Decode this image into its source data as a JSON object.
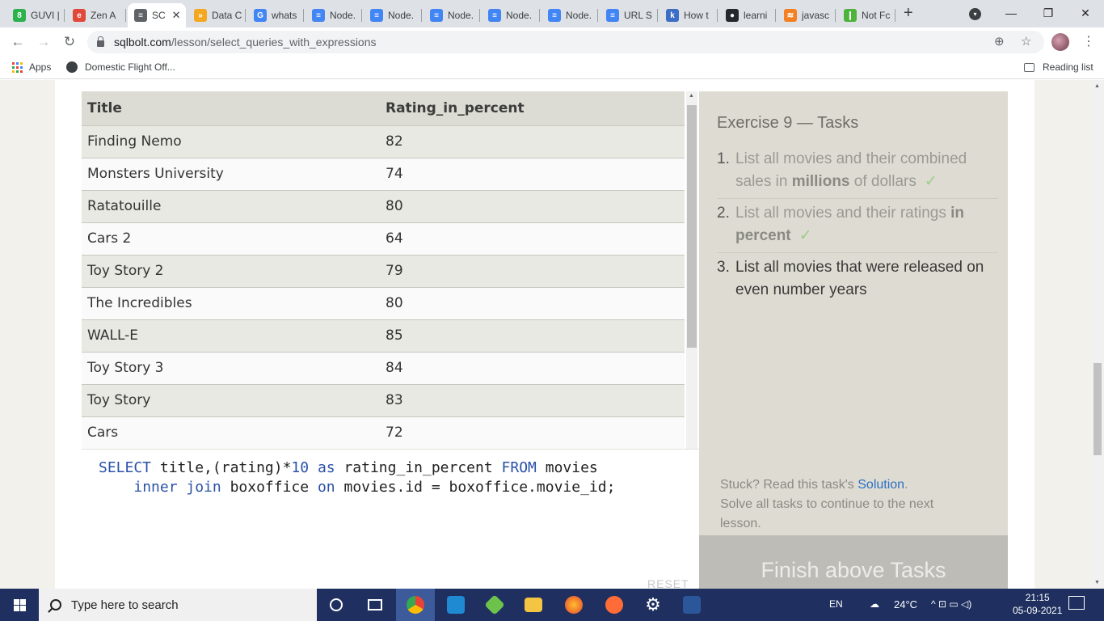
{
  "browser": {
    "tabs": [
      {
        "label": "GUVI |",
        "favicon_color": "#2bb24c",
        "favicon_glyph": "8"
      },
      {
        "label": "Zen A",
        "favicon_color": "#e0483a",
        "favicon_glyph": "e"
      },
      {
        "label": "SC",
        "favicon_color": "#5f6368",
        "favicon_glyph": "≡",
        "active": true,
        "close": "✕"
      },
      {
        "label": "Data C",
        "favicon_color": "#f4a821",
        "favicon_glyph": "»"
      },
      {
        "label": "whats",
        "favicon_color": "#4285f4",
        "favicon_glyph": "G"
      },
      {
        "label": "Node.",
        "favicon_color": "#4285f4",
        "favicon_glyph": "≡"
      },
      {
        "label": "Node.",
        "favicon_color": "#4285f4",
        "favicon_glyph": "≡"
      },
      {
        "label": "Node.",
        "favicon_color": "#4285f4",
        "favicon_glyph": "≡"
      },
      {
        "label": "Node.",
        "favicon_color": "#4285f4",
        "favicon_glyph": "≡"
      },
      {
        "label": "Node.",
        "favicon_color": "#4285f4",
        "favicon_glyph": "≡"
      },
      {
        "label": "URL S",
        "favicon_color": "#4285f4",
        "favicon_glyph": "≡"
      },
      {
        "label": "How t",
        "favicon_color": "#3b6ec4",
        "favicon_glyph": "k"
      },
      {
        "label": "learni",
        "favicon_color": "#24292e",
        "favicon_glyph": "●"
      },
      {
        "label": "javasc",
        "favicon_color": "#f48024",
        "favicon_glyph": "≋"
      },
      {
        "label": "Not Fc",
        "favicon_color": "#4db33d",
        "favicon_glyph": "❙"
      }
    ],
    "new_tab_glyph": "+",
    "window_controls": {
      "minimize": "—",
      "maximize": "❐",
      "close": "✕"
    },
    "url_host": "sqlbolt.com",
    "url_path": "/lesson/select_queries_with_expressions",
    "nav": {
      "back": "←",
      "forward": "→",
      "reload": "↻"
    },
    "omnibox_icons": {
      "zoom": "⊕",
      "star": "☆"
    },
    "kebab": "⋮",
    "bookmarks": {
      "apps": "Apps",
      "domestic": "Domestic Flight Off...",
      "reading_list": "Reading list"
    }
  },
  "results": {
    "columns": [
      "Title",
      "Rating_in_percent"
    ],
    "rows": [
      [
        "Finding Nemo",
        "82"
      ],
      [
        "Monsters University",
        "74"
      ],
      [
        "Ratatouille",
        "80"
      ],
      [
        "Cars 2",
        "64"
      ],
      [
        "Toy Story 2",
        "79"
      ],
      [
        "The Incredibles",
        "80"
      ],
      [
        "WALL-E",
        "85"
      ],
      [
        "Toy Story 3",
        "84"
      ],
      [
        "Toy Story",
        "83"
      ],
      [
        "Cars",
        "72"
      ]
    ]
  },
  "editor": {
    "line1": {
      "kw1": "SELECT",
      "t1": " title,(rating)*",
      "num": "10",
      "kw2": " as",
      "t2": " rating_in_percent ",
      "kw3": "FROM",
      "t3": " movies"
    },
    "line2": {
      "indent": "    ",
      "kw1": "inner join",
      "t1": " boxoffice ",
      "kw2": "on",
      "t2": " movies.id = boxoffice.movie_id;"
    },
    "reset_label": "RESET"
  },
  "tasks": {
    "title": "Exercise 9 — Tasks",
    "items": [
      {
        "num": "1.",
        "text_a": "List all movies and their combined sales in ",
        "bold": "millions",
        "text_b": " of dollars",
        "check": "✓"
      },
      {
        "num": "2.",
        "text_a": "List all movies and their ratings ",
        "bold": "in percent",
        "text_b": "",
        "check": "✓"
      },
      {
        "num": "3.",
        "text": "List all movies that were released on even number years"
      }
    ],
    "stuck_prefix": "Stuck? Read this task's ",
    "solution_link": "Solution",
    "stuck_suffix": ".",
    "solve_all": "Solve all tasks to continue to the next lesson.",
    "finish_button": "Finish above Tasks"
  },
  "taskbar": {
    "search_placeholder": "Type here to search",
    "language": "EN",
    "weather": "24°C",
    "tray_icons": "^ ⊡ ▭ ◁)",
    "time": "21:15",
    "date": "05-09-2021"
  },
  "colors": {
    "accent_link": "#2b6fc4",
    "sql_keyword": "#2b52a8",
    "check": "#9ccc8a",
    "taskbar": "#1f3060"
  }
}
